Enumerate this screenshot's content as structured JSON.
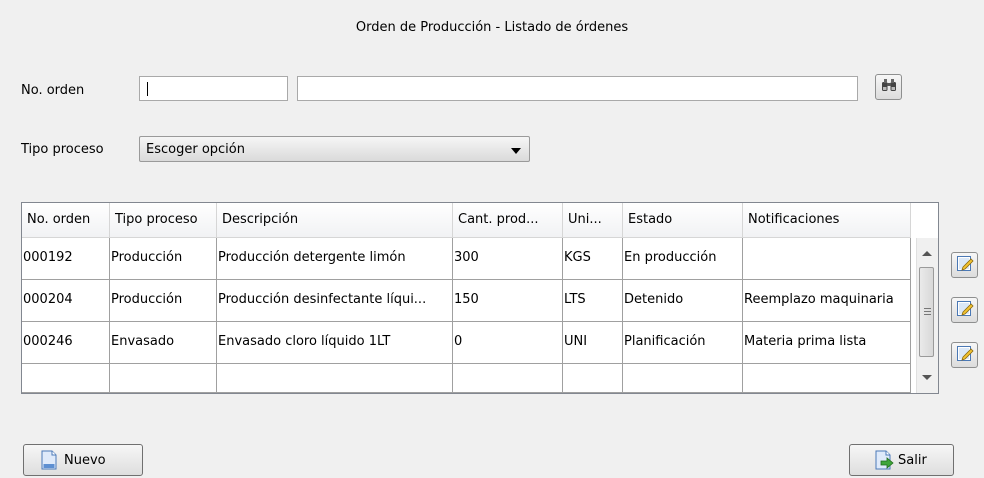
{
  "window": {
    "title": "Orden de Producción - Listado de órdenes"
  },
  "filters": {
    "order_label": "No. orden",
    "order_value": "",
    "order_desc_value": "",
    "search_icon": "binoculars-icon",
    "process_label": "Tipo proceso",
    "process_selected": "Escoger opción"
  },
  "table": {
    "columns": [
      "No. orden",
      "Tipo proceso",
      "Descripción",
      "Cant. prod...",
      "Uni...",
      "Estado",
      "Notificaciones"
    ],
    "rows": [
      [
        "000192",
        "Producción",
        "Producción detergente limón",
        "300",
        "KGS",
        "En producción",
        ""
      ],
      [
        "000204",
        "Producción",
        "Producción desinfectante líqui...",
        "150",
        "LTS",
        "Detenido",
        "Reemplazo maquinaria"
      ],
      [
        "000246",
        "Envasado",
        "Envasado cloro líquido 1LT",
        "0",
        "UNI",
        "Planificación",
        "Materia prima lista"
      ]
    ],
    "edit_icon": "pencil-edit-icon"
  },
  "buttons": {
    "new_label": "Nuevo",
    "exit_label": "Salir"
  }
}
